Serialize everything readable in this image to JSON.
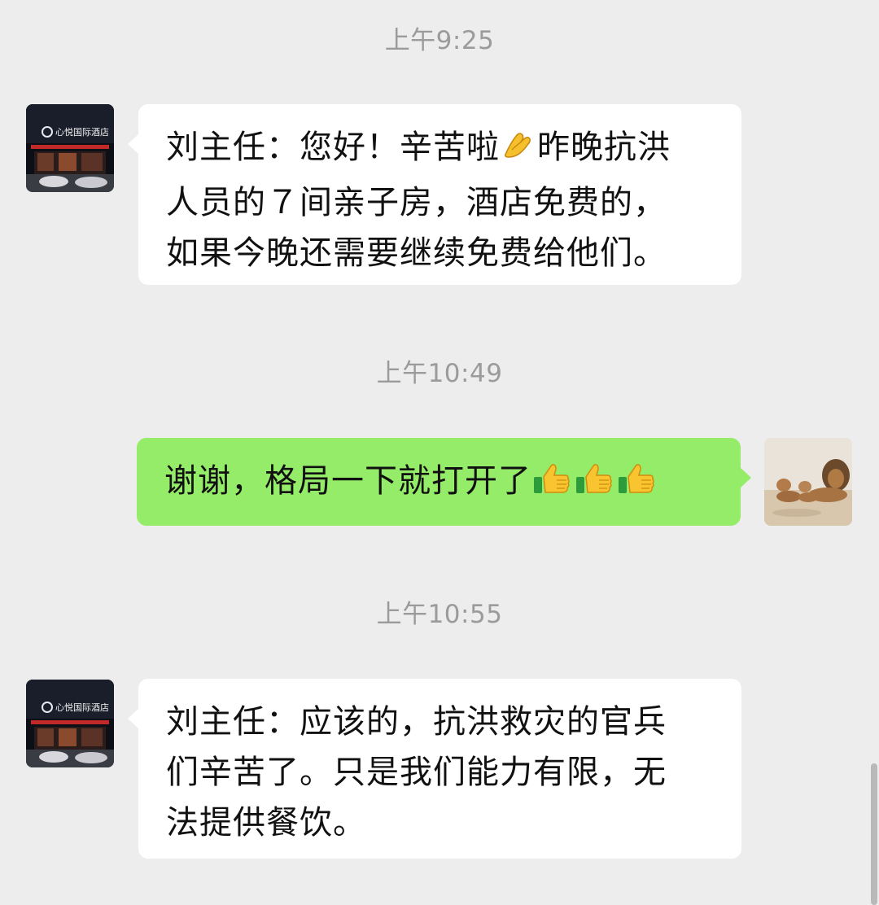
{
  "colors": {
    "background": "#ededed",
    "incoming_bubble": "#ffffff",
    "outgoing_bubble": "#95ec69",
    "timestamp_text": "#9b9b9b"
  },
  "messages": [
    {
      "timestamp": "上午9:25",
      "direction": "incoming",
      "avatar": "hotel-storefront-avatar",
      "avatar_text": "心悦国际酒店",
      "lines": [
        {
          "parts": [
            "刘主任：您好！辛苦啦",
            "{{emoji:pinched-hand}}",
            "昨晚抗洪"
          ]
        },
        {
          "parts": [
            "人员的７间亲子房，酒店免费的，"
          ]
        },
        {
          "parts": [
            "如果今晚还需要继续免费给他们。"
          ]
        }
      ]
    },
    {
      "timestamp": "上午10:49",
      "direction": "outgoing",
      "avatar": "lions-avatar",
      "lines": [
        {
          "parts": [
            "谢谢，格局一下就打开了",
            "{{emoji:thumbs-up}}",
            "{{emoji:thumbs-up}}",
            "{{emoji:thumbs-up}}"
          ]
        }
      ]
    },
    {
      "timestamp": "上午10:55",
      "direction": "incoming",
      "avatar": "hotel-storefront-avatar",
      "avatar_text": "心悦国际酒店",
      "lines": [
        {
          "parts": [
            "刘主任：应该的，抗洪救灾的官兵"
          ]
        },
        {
          "parts": [
            "们辛苦了。只是我们能力有限，无"
          ]
        },
        {
          "parts": [
            "法提供餐饮。"
          ]
        }
      ]
    }
  ],
  "text": {
    "ts1": "上午9:25",
    "ts2": "上午10:49",
    "ts3": "上午10:55",
    "m1_a": "刘主任：您好！辛苦啦",
    "m1_b": "昨晚抗洪",
    "m1_line2": "人员的７间亲子房，酒店免费的，",
    "m1_line3": "如果今晚还需要继续免费给他们。",
    "m2": "谢谢，格局一下就打开了",
    "m3_line1": "刘主任：应该的，抗洪救灾的官兵",
    "m3_line2": "们辛苦了。只是我们能力有限，无",
    "m3_line3": "法提供餐饮。",
    "hotel_sign": "心悦国际酒店"
  }
}
